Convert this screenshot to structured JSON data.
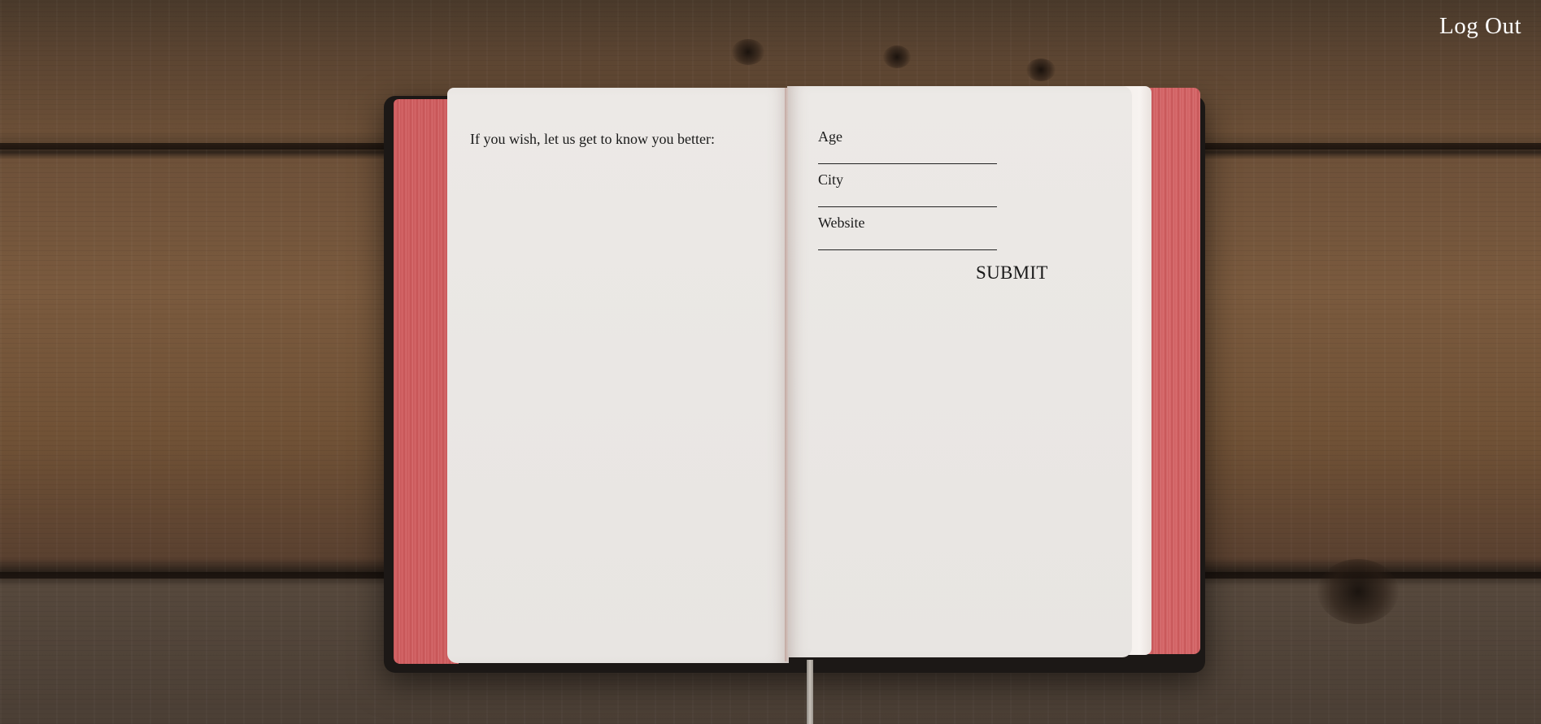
{
  "header": {
    "logout_label": "Log Out"
  },
  "book": {
    "left_page": {
      "intro_text": "If you wish, let us get to know you better:"
    },
    "form": {
      "fields": [
        {
          "label": "Age",
          "value": ""
        },
        {
          "label": "City",
          "value": ""
        },
        {
          "label": "Website",
          "value": ""
        }
      ],
      "submit_label": "SUBMIT"
    }
  },
  "colors": {
    "page": "#eae7e4",
    "page_edges": "#d46668",
    "logout_text": "#ffffff",
    "ink": "#1a1a1a"
  }
}
